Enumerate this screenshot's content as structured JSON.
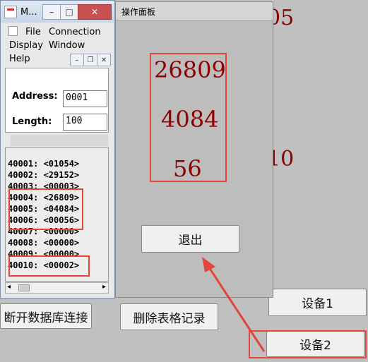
{
  "background_app": {
    "numbers_right": [
      "05",
      "10"
    ],
    "buttons": {
      "disconnect": "断开数据库连接",
      "delete_records": "删除表格记录",
      "device1": "设备1",
      "device2": "设备2"
    }
  },
  "modbus_window": {
    "title": "M...",
    "menu": [
      "File",
      "Connection",
      "Display",
      "Window",
      "Help"
    ],
    "address_label": "Address:",
    "address_value": "0001",
    "length_label": "Length:",
    "length_value": "100",
    "registers": [
      "40001: <01054>",
      "40002: <29152>",
      "40003: <00003>",
      "40004: <26809>",
      "40005: <04084>",
      "40006: <00056>",
      "40007: <00000>",
      "40008: <00000>",
      "40009: <00000>",
      "40010: <00002>"
    ]
  },
  "operation_panel": {
    "title": "操作面板",
    "values": [
      "26809",
      "4084",
      "56"
    ],
    "exit_button": "退出"
  },
  "colors": {
    "value_red": "#8b0000",
    "highlight_red": "#e0473a"
  }
}
